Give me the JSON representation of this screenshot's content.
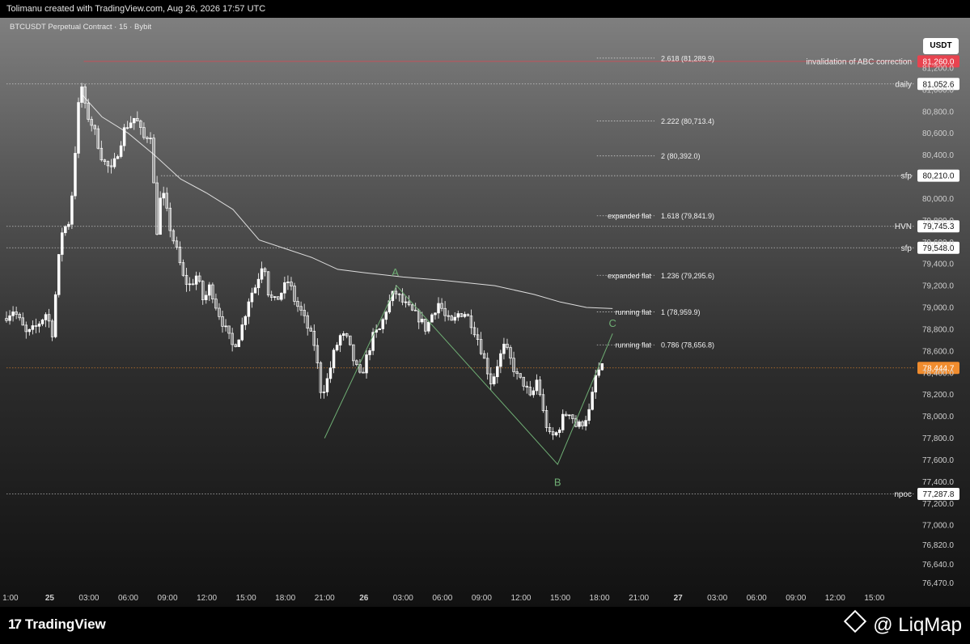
{
  "header": {
    "caption": "Tolimanu created with TradingView.com, Aug 26, 2026 17:57 UTC"
  },
  "usdt_button": "USDT",
  "footer": {
    "left_brand": "TradingView",
    "right_brand": "@ LiqMap"
  },
  "colors": {
    "candle_up": "#ffffff",
    "candle_down": "#ffffff",
    "wave": "#6fae74",
    "invalidation": "#e8434f",
    "current_price": "#f08c2e",
    "vwap": "#dddddd"
  },
  "chart_data": {
    "type": "candlestick",
    "title": "BTCUSDT Perpetual Contract · 15 · Bybit",
    "ylim": [
      76400,
      81400
    ],
    "y_ticks": [
      {
        "value": 81200,
        "label": "81,200.0"
      },
      {
        "value": 81000,
        "label": "81,000.0"
      },
      {
        "value": 80800,
        "label": "80,800.0"
      },
      {
        "value": 80600,
        "label": "80,600.0"
      },
      {
        "value": 80400,
        "label": "80,400.0"
      },
      {
        "value": 80000,
        "label": "80,000.0"
      },
      {
        "value": 79800,
        "label": "79,800.0"
      },
      {
        "value": 79600,
        "label": "79,600.0"
      },
      {
        "value": 79400,
        "label": "79,400.0"
      },
      {
        "value": 79200,
        "label": "79,200.0"
      },
      {
        "value": 79000,
        "label": "79,000.0"
      },
      {
        "value": 78800,
        "label": "78,800.0"
      },
      {
        "value": 78600,
        "label": "78,600.0"
      },
      {
        "value": 78400,
        "label": "78,400.0"
      },
      {
        "value": 78200,
        "label": "78,200.0"
      },
      {
        "value": 78000,
        "label": "78,000.0"
      },
      {
        "value": 77800,
        "label": "77,800.0"
      },
      {
        "value": 77600,
        "label": "77,600.0"
      },
      {
        "value": 77400,
        "label": "77,400.0"
      },
      {
        "value": 77200,
        "label": "77,200.0"
      },
      {
        "value": 77000,
        "label": "77,000.0"
      },
      {
        "value": 76820,
        "label": "76,820.0"
      },
      {
        "value": 76640,
        "label": "76,640.0"
      },
      {
        "value": 76470,
        "label": "76,470.0"
      }
    ],
    "x_ticks": [
      {
        "hour": -3,
        "label": "1:00"
      },
      {
        "hour": 0,
        "label": "25",
        "bold": true
      },
      {
        "hour": 3,
        "label": "03:00"
      },
      {
        "hour": 6,
        "label": "06:00"
      },
      {
        "hour": 9,
        "label": "09:00"
      },
      {
        "hour": 12,
        "label": "12:00"
      },
      {
        "hour": 15,
        "label": "15:00"
      },
      {
        "hour": 18,
        "label": "18:00"
      },
      {
        "hour": 21,
        "label": "21:00"
      },
      {
        "hour": 24,
        "label": "26",
        "bold": true
      },
      {
        "hour": 27,
        "label": "03:00"
      },
      {
        "hour": 30,
        "label": "06:00"
      },
      {
        "hour": 33,
        "label": "09:00"
      },
      {
        "hour": 36,
        "label": "12:00"
      },
      {
        "hour": 39,
        "label": "15:00"
      },
      {
        "hour": 42,
        "label": "18:00"
      },
      {
        "hour": 45,
        "label": "21:00"
      },
      {
        "hour": 48,
        "label": "27",
        "bold": true
      },
      {
        "hour": 51,
        "label": "03:00"
      },
      {
        "hour": 54,
        "label": "06:00"
      },
      {
        "hour": 57,
        "label": "09:00"
      },
      {
        "hour": 60,
        "label": "12:00"
      },
      {
        "hour": 63,
        "label": "15:00"
      }
    ],
    "x_hour_range": [
      -3.3,
      64.8
    ],
    "key_levels": [
      {
        "name": "invalidation of ABC correction",
        "price": 81260.0,
        "badge": "81,260.0",
        "style": "invalidation",
        "start_hour": 2.6
      },
      {
        "name": "daily",
        "price": 81052.6,
        "badge": "81,052.6",
        "style": "level",
        "start_hour": -3.3
      },
      {
        "name": "sfp",
        "price": 80210.0,
        "badge": "80,210.0",
        "style": "level",
        "start_hour": 8.5
      },
      {
        "name": "HVN",
        "price": 79745.3,
        "badge": "79,745.3",
        "style": "level",
        "start_hour": -3.3
      },
      {
        "name": "sfp",
        "price": 79548.0,
        "badge": "79,548.0",
        "style": "level",
        "start_hour": -3.3
      },
      {
        "name": "npoc",
        "price": 77287.8,
        "badge": "77,287.8",
        "style": "level",
        "start_hour": -3.3
      }
    ],
    "current_price": {
      "price": 78444.7,
      "label": "78,444.7"
    },
    "fib_levels": [
      {
        "price": 81289.9,
        "label": "2.618 (81,289.9)",
        "note": ""
      },
      {
        "price": 80713.4,
        "label": "2.222 (80,713.4)",
        "note": ""
      },
      {
        "price": 80392.0,
        "label": "2 (80,392.0)",
        "note": ""
      },
      {
        "price": 79841.9,
        "label": "1.618 (79,841.9)",
        "note": "expanded flat"
      },
      {
        "price": 79295.6,
        "label": "1.236 (79,295.6)",
        "note": "expanded flat"
      },
      {
        "price": 78959.9,
        "label": "1 (78,959.9)",
        "note": "running flat"
      },
      {
        "price": 78656.8,
        "label": "0.786 (78,656.8)",
        "note": "running flat"
      }
    ],
    "wave_path": [
      {
        "hour": 21.0,
        "price": 77800
      },
      {
        "hour": 26.5,
        "price": 79200
      },
      {
        "hour": 38.8,
        "price": 77560
      },
      {
        "hour": 43.0,
        "price": 78760
      }
    ],
    "wave_labels": [
      {
        "text": "A",
        "hour": 26.4,
        "price": 79320
      },
      {
        "text": "B",
        "hour": 38.8,
        "price": 77390
      },
      {
        "text": "C",
        "hour": 43.0,
        "price": 78850
      }
    ],
    "vwap": [
      {
        "hour": 2.5,
        "price": 80950
      },
      {
        "hour": 4.0,
        "price": 80750
      },
      {
        "hour": 6.0,
        "price": 80600
      },
      {
        "hour": 8.0,
        "price": 80400
      },
      {
        "hour": 10.0,
        "price": 80180
      },
      {
        "hour": 12.0,
        "price": 80050
      },
      {
        "hour": 14.0,
        "price": 79900
      },
      {
        "hour": 16.0,
        "price": 79620
      },
      {
        "hour": 18.0,
        "price": 79540
      },
      {
        "hour": 20.0,
        "price": 79460
      },
      {
        "hour": 22.0,
        "price": 79350
      },
      {
        "hour": 24.0,
        "price": 79320
      },
      {
        "hour": 27.0,
        "price": 79280
      },
      {
        "hour": 30.0,
        "price": 79250
      },
      {
        "hour": 34.0,
        "price": 79200
      },
      {
        "hour": 37.0,
        "price": 79120
      },
      {
        "hour": 39.0,
        "price": 79050
      },
      {
        "hour": 41.0,
        "price": 79000
      },
      {
        "hour": 43.0,
        "price": 78990
      }
    ],
    "price_path": [
      {
        "hour": -3.3,
        "price": 78900
      },
      {
        "hour": -2.5,
        "price": 78980
      },
      {
        "hour": -1.5,
        "price": 78750
      },
      {
        "hour": -0.8,
        "price": 78820
      },
      {
        "hour": 0.0,
        "price": 78950
      },
      {
        "hour": 0.5,
        "price": 78750
      },
      {
        "hour": 0.8,
        "price": 79300
      },
      {
        "hour": 1.2,
        "price": 79700
      },
      {
        "hour": 1.8,
        "price": 79800
      },
      {
        "hour": 2.3,
        "price": 80600
      },
      {
        "hour": 2.6,
        "price": 81100
      },
      {
        "hour": 3.0,
        "price": 80800
      },
      {
        "hour": 3.6,
        "price": 80650
      },
      {
        "hour": 4.3,
        "price": 80350
      },
      {
        "hour": 5.0,
        "price": 80250
      },
      {
        "hour": 5.5,
        "price": 80450
      },
      {
        "hour": 6.0,
        "price": 80650
      },
      {
        "hour": 6.8,
        "price": 80750
      },
      {
        "hour": 7.4,
        "price": 80550
      },
      {
        "hour": 8.0,
        "price": 80600
      },
      {
        "hour": 8.4,
        "price": 79650
      },
      {
        "hour": 8.8,
        "price": 80100
      },
      {
        "hour": 9.5,
        "price": 79700
      },
      {
        "hour": 10.0,
        "price": 79500
      },
      {
        "hour": 10.5,
        "price": 79250
      },
      {
        "hour": 11.0,
        "price": 79200
      },
      {
        "hour": 11.5,
        "price": 79300
      },
      {
        "hour": 12.0,
        "price": 79050
      },
      {
        "hour": 12.5,
        "price": 79200
      },
      {
        "hour": 13.0,
        "price": 79000
      },
      {
        "hour": 13.5,
        "price": 78850
      },
      {
        "hour": 14.2,
        "price": 78650
      },
      {
        "hour": 14.6,
        "price": 78700
      },
      {
        "hour": 15.0,
        "price": 78850
      },
      {
        "hour": 15.5,
        "price": 79100
      },
      {
        "hour": 16.0,
        "price": 79200
      },
      {
        "hour": 16.6,
        "price": 79450
      },
      {
        "hour": 17.0,
        "price": 79100
      },
      {
        "hour": 17.5,
        "price": 79050
      },
      {
        "hour": 18.0,
        "price": 79150
      },
      {
        "hour": 18.5,
        "price": 79250
      },
      {
        "hour": 19.0,
        "price": 79050
      },
      {
        "hour": 19.5,
        "price": 78950
      },
      {
        "hour": 20.0,
        "price": 78800
      },
      {
        "hour": 20.5,
        "price": 78650
      },
      {
        "hour": 21.0,
        "price": 78200
      },
      {
        "hour": 21.5,
        "price": 78350
      },
      {
        "hour": 22.0,
        "price": 78600
      },
      {
        "hour": 22.5,
        "price": 78750
      },
      {
        "hour": 23.0,
        "price": 78700
      },
      {
        "hour": 23.5,
        "price": 78500
      },
      {
        "hour": 24.0,
        "price": 78350
      },
      {
        "hour": 24.6,
        "price": 78600
      },
      {
        "hour": 25.0,
        "price": 78750
      },
      {
        "hour": 25.5,
        "price": 78800
      },
      {
        "hour": 26.0,
        "price": 79000
      },
      {
        "hour": 26.6,
        "price": 79150
      },
      {
        "hour": 27.2,
        "price": 79050
      },
      {
        "hour": 28.0,
        "price": 78950
      },
      {
        "hour": 28.5,
        "price": 78900
      },
      {
        "hour": 29.0,
        "price": 78800
      },
      {
        "hour": 29.5,
        "price": 78950
      },
      {
        "hour": 30.0,
        "price": 79050
      },
      {
        "hour": 30.5,
        "price": 78900
      },
      {
        "hour": 31.0,
        "price": 78850
      },
      {
        "hour": 31.5,
        "price": 78950
      },
      {
        "hour": 32.0,
        "price": 78950
      },
      {
        "hour": 32.5,
        "price": 78850
      },
      {
        "hour": 33.0,
        "price": 78700
      },
      {
        "hour": 33.5,
        "price": 78500
      },
      {
        "hour": 34.0,
        "price": 78300
      },
      {
        "hour": 34.5,
        "price": 78500
      },
      {
        "hour": 35.0,
        "price": 78650
      },
      {
        "hour": 35.5,
        "price": 78500
      },
      {
        "hour": 36.0,
        "price": 78350
      },
      {
        "hour": 36.5,
        "price": 78300
      },
      {
        "hour": 37.0,
        "price": 78150
      },
      {
        "hour": 37.5,
        "price": 78350
      },
      {
        "hour": 38.0,
        "price": 78000
      },
      {
        "hour": 38.5,
        "price": 77800
      },
      {
        "hour": 39.0,
        "price": 77850
      },
      {
        "hour": 39.5,
        "price": 78000
      },
      {
        "hour": 40.0,
        "price": 78050
      },
      {
        "hour": 40.5,
        "price": 77900
      },
      {
        "hour": 41.0,
        "price": 77950
      },
      {
        "hour": 41.5,
        "price": 78050
      },
      {
        "hour": 42.0,
        "price": 78400
      },
      {
        "hour": 42.4,
        "price": 78440
      }
    ]
  }
}
